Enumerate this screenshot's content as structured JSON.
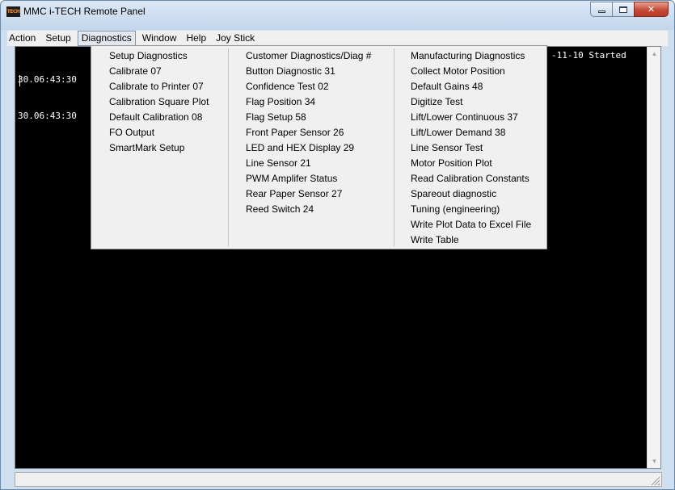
{
  "window": {
    "title": "MMC i-TECH Remote Panel",
    "icon": "tech-app-icon",
    "icon_text": "TECH"
  },
  "menubar": {
    "items": [
      "Action",
      "Setup",
      "Diagnostics",
      "Window",
      "Help",
      "Joy Stick"
    ],
    "active": "Diagnostics"
  },
  "console": {
    "lines": [
      "30.06:43:30",
      "30.06:43:30"
    ],
    "right_text": "-11-10 Started"
  },
  "diagnostics_menu": {
    "column1": [
      "Setup Diagnostics",
      "Calibrate 07",
      "Calibrate to Printer 07",
      "Calibration Square Plot",
      "Default Calibration 08",
      "FO Output",
      "SmartMark Setup"
    ],
    "column2": [
      "Customer Diagnostics/Diag #",
      "Button Diagnostic 31",
      "Confidence Test 02",
      "Flag Position 34",
      "Flag Setup 58",
      "Front Paper Sensor 26",
      "LED and HEX Display 29",
      "Line Sensor 21",
      "PWM Amplifer Status",
      "Rear Paper Sensor 27",
      "Reed Switch 24"
    ],
    "column3": [
      "Manufacturing Diagnostics",
      "Collect Motor Position",
      "Default Gains 48",
      "Digitize Test",
      "Lift/Lower Continuous 37",
      "Lift/Lower Demand 38",
      "Line Sensor Test",
      "Motor Position Plot",
      "Read Calibration Constants",
      "Spareout diagnostic",
      "Tuning (engineering)",
      "Write Plot Data to Excel File",
      "Write Table"
    ]
  },
  "colors": {
    "console_bg": "#000000",
    "console_fg": "#ffffff",
    "frame": "#cfdff0",
    "close_button": "#c44b36"
  }
}
